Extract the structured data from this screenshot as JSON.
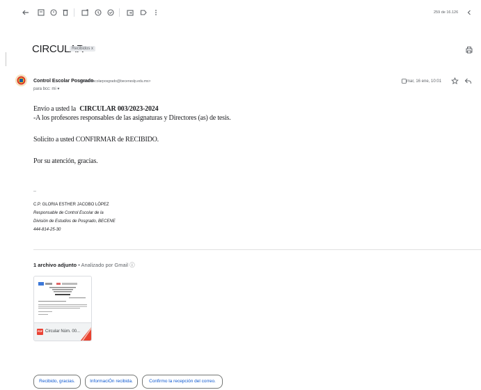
{
  "toolbar": {
    "back_icon": "arrow-left-icon",
    "archive_icon": "archive-icon",
    "report_icon": "report-spam-icon",
    "delete_icon": "trash-icon",
    "mark_unread_icon": "mail-unread-icon",
    "snooze_icon": "clock-icon",
    "add_task_icon": "task-add-icon",
    "move_icon": "folder-move-icon",
    "label_icon": "label-icon",
    "more_icon": "more-vertical-icon",
    "pagination": "259 de 16.126",
    "prev_icon": "chevron-left-icon"
  },
  "message": {
    "subject": "CIRCULAR",
    "label_chip": "Recibidos x",
    "print_icon": "print-icon",
    "sender_name": "Control Escolar Posgrado",
    "sender_email": "<controlescolarposgrado@beceneslp.edu.mx>",
    "to_line": "para bcc: mi ▾",
    "date": "mar, 16 ene, 10:01",
    "star_icon": "star-icon",
    "reply_icon": "reply-icon"
  },
  "body": {
    "line1_prefix": "Envío a usted la",
    "line1_bold": "CIRCULAR  003/2023-2024",
    "line2": "-A los profesores responsables de las asignaturas y Directores (as) de tesis.",
    "line3": "Solicito a usted CONFIRMAR de RECIBIDO.",
    "line4": "Por su atención, gracias."
  },
  "signature": {
    "dash": "--",
    "name": "C.P. GLORIA ESTHER JACOBO LÓPEZ",
    "role1": "Responsable de Control Escolar de la",
    "role2": "División de Estudios de Posgrado, BECENE",
    "phone": "444-814-25-30"
  },
  "attachments": {
    "count_label": "1 archivo adjunto",
    "scan_label": " • Analizado por Gmail ⓘ",
    "file_name": "Circular Núm. 00...",
    "file_type": "PDF"
  },
  "smart_replies": [
    "Recibido, gracias.",
    "InformaciÓn recibida.",
    "Confirmo la recepción del correo."
  ]
}
